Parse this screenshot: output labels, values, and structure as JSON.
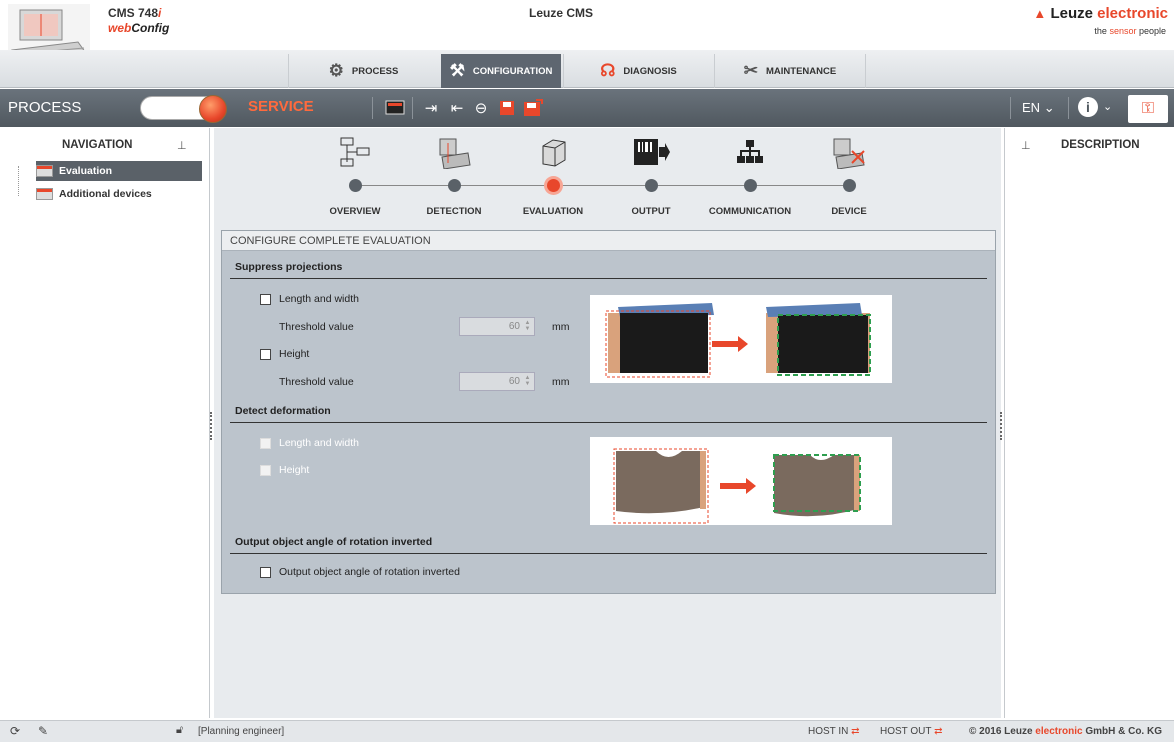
{
  "header": {
    "product_name": "CMS 748",
    "product_suffix": "i",
    "product_sub_prefix": "web",
    "product_sub": "Config",
    "app_title": "Leuze CMS",
    "brand_name": "Leuze",
    "brand_accent": "electronic",
    "tagline_prefix": "the",
    "tagline_accent": "sensor",
    "tagline_suffix": "people"
  },
  "tabs": [
    {
      "label": "PROCESS",
      "icon": "process-gear-icon",
      "active": false
    },
    {
      "label": "CONFIGURATION",
      "icon": "configuration-icon",
      "active": true
    },
    {
      "label": "DIAGNOSIS",
      "icon": "diagnosis-icon",
      "active": false
    },
    {
      "label": "MAINTENANCE",
      "icon": "maintenance-tools-icon",
      "active": false
    }
  ],
  "toolbar": {
    "process_label": "PROCESS",
    "service_label": "SERVICE",
    "language": "EN",
    "icons": [
      "monitor-icon",
      "upload-icon",
      "download-icon",
      "undo-icon",
      "save-icon",
      "save-as-icon"
    ]
  },
  "navigation": {
    "title": "NAVIGATION",
    "items": [
      {
        "label": "Evaluation",
        "selected": true
      },
      {
        "label": "Additional devices",
        "selected": false
      }
    ]
  },
  "description": {
    "title": "DESCRIPTION"
  },
  "steps": [
    {
      "label": "OVERVIEW",
      "active": false
    },
    {
      "label": "DETECTION",
      "active": false
    },
    {
      "label": "EVALUATION",
      "active": true
    },
    {
      "label": "OUTPUT",
      "active": false
    },
    {
      "label": "COMMUNICATION",
      "active": false
    },
    {
      "label": "DEVICE",
      "active": false
    }
  ],
  "config": {
    "title": "CONFIGURE COMPLETE EVALUATION",
    "suppress": {
      "title": "Suppress projections",
      "length_width_label": "Length and width",
      "threshold_label_1": "Threshold value",
      "threshold_value_1": "60",
      "unit_1": "mm",
      "height_label": "Height",
      "threshold_label_2": "Threshold value",
      "threshold_value_2": "60",
      "unit_2": "mm"
    },
    "deform": {
      "title": "Detect deformation",
      "length_width_label": "Length and width",
      "height_label": "Height"
    },
    "rotation": {
      "title": "Output object angle of rotation inverted",
      "checkbox_label": "Output object angle of rotation inverted"
    }
  },
  "statusbar": {
    "user": "[Planning engineer]",
    "host_in": "HOST IN",
    "host_out": "HOST OUT",
    "copyright_prefix": "© 2016 Leuze",
    "copyright_accent": "electronic",
    "copyright_suffix": "GmbH & Co. KG"
  },
  "colors": {
    "accent": "#e8472b",
    "toolbar": "#5e6670",
    "panel": "#bcc4cc"
  }
}
